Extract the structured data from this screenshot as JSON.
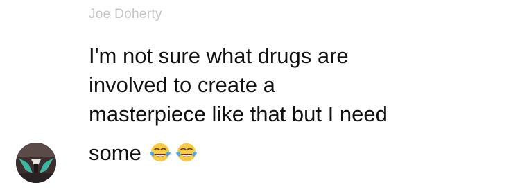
{
  "message": {
    "sender_name": "Joe Doherty",
    "lines": [
      "I'm not sure what drugs are",
      "involved to create a",
      "masterpiece like that but I need"
    ],
    "last_line_text": "some",
    "emojis": [
      "face-with-tears-of-joy",
      "face-with-tears-of-joy"
    ]
  },
  "colors": {
    "sender_name": "#c4c4c4",
    "message_text": "#111111",
    "background": "#ffffff"
  }
}
